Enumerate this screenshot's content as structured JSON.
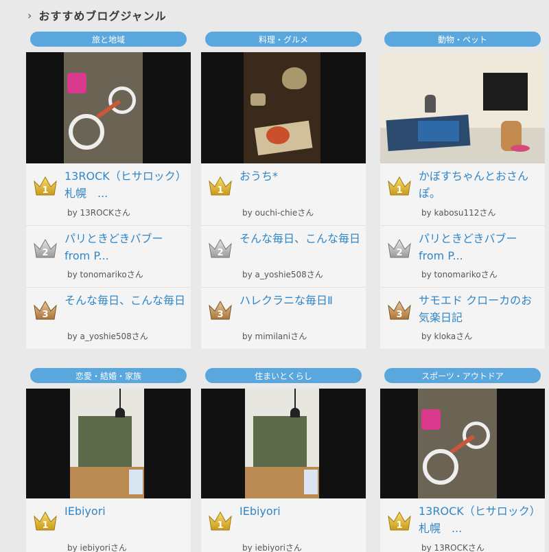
{
  "header": {
    "title": "おすすめブログジャンル"
  },
  "colors": {
    "genre_pill": "#5aa7dd",
    "link": "#2f86c9"
  },
  "cards": [
    {
      "genre": "旅と地域",
      "photo": "bicycle-photo",
      "ranks": [
        {
          "rank": 1,
          "blog": "13ROCK（ヒサロック）　札幌　...",
          "author": "by 13ROCKさん"
        },
        {
          "rank": 2,
          "blog": "パリときどきバブー　from P...",
          "author": "by tonomarikoさん"
        },
        {
          "rank": 3,
          "blog": "そんな毎日、こんな毎日",
          "author": "by a_yoshie508さん"
        }
      ]
    },
    {
      "genre": "料理・グルメ",
      "photo": "food-photo",
      "ranks": [
        {
          "rank": 1,
          "blog": "おうち*",
          "author": "by ouchi-chieさん"
        },
        {
          "rank": 2,
          "blog": "そんな毎日、こんな毎日",
          "author": "by a_yoshie508さん"
        },
        {
          "rank": 3,
          "blog": "ハレクラニな毎日Ⅱ",
          "author": "by mimilaniさん"
        }
      ]
    },
    {
      "genre": "動物・ペット",
      "photo": "pets-photo",
      "ranks": [
        {
          "rank": 1,
          "blog": "かぼすちゃんとおさんぽ。",
          "author": "by kabosu112さん"
        },
        {
          "rank": 2,
          "blog": "パリときどきバブー　from P...",
          "author": "by tonomarikoさん"
        },
        {
          "rank": 3,
          "blog": "サモエド クローカのお気楽日記",
          "author": "by klokaさん"
        }
      ]
    },
    {
      "genre": "恋愛・結婚・家族",
      "photo": "room-photo",
      "ranks": [
        {
          "rank": 1,
          "blog": "IEbiyori",
          "author": "by iebiyoriさん"
        }
      ]
    },
    {
      "genre": "住まいとくらし",
      "photo": "room-photo",
      "ranks": [
        {
          "rank": 1,
          "blog": "IEbiyori",
          "author": "by iebiyoriさん"
        }
      ]
    },
    {
      "genre": "スポーツ・アウトドア",
      "photo": "bicycle-photo",
      "ranks": [
        {
          "rank": 1,
          "blog": "13ROCK（ヒサロック）　札幌　...",
          "author": "by 13ROCKさん"
        }
      ]
    }
  ]
}
